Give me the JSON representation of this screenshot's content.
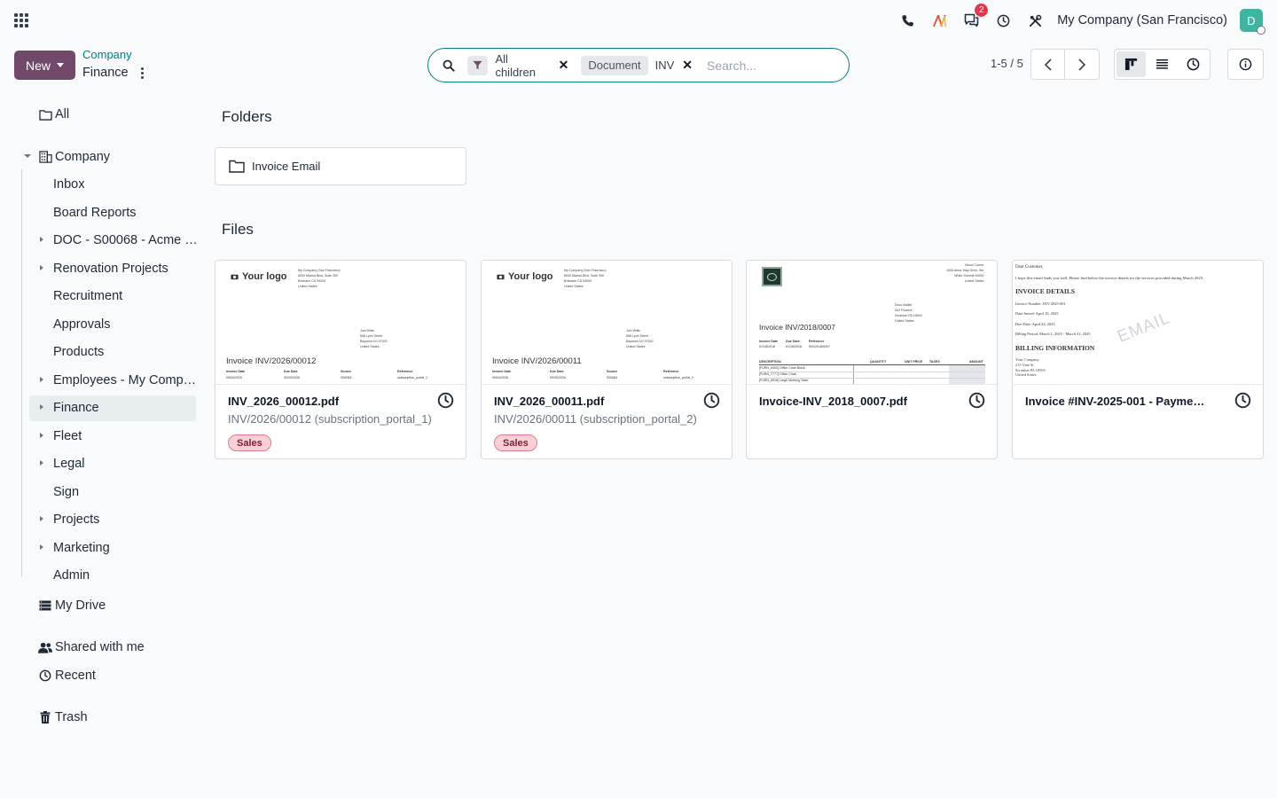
{
  "navbar": {
    "company": "My Company (San Francisco)",
    "messages_badge": "2",
    "avatar_initial": "D",
    "icons": [
      "apps-grid-icon",
      "phone-icon",
      "ai-icon",
      "messages-icon",
      "clock-icon",
      "tools-icon"
    ]
  },
  "control": {
    "new_label": "New",
    "breadcrumb_parent": "Company",
    "breadcrumb_current": "Finance"
  },
  "search": {
    "facet_filter": "All children",
    "facet_field": "Document",
    "facet_value": "INV",
    "placeholder": "Search..."
  },
  "pager": {
    "label": "1-5 / 5"
  },
  "sidebar": {
    "all": "All",
    "company": "Company",
    "children": [
      "Inbox",
      "Board Reports",
      "DOC - S00068 - Acme …",
      "Renovation Projects",
      "Recruitment",
      "Approvals",
      "Products",
      "Employees - My Comp…",
      "Finance",
      "Fleet",
      "Legal",
      "Sign",
      "Projects",
      "Marketing",
      "Admin"
    ],
    "my_drive": "My Drive",
    "shared": "Shared with me",
    "recent": "Recent",
    "trash": "Trash"
  },
  "main": {
    "folders_title": "Folders",
    "files_title": "Files",
    "folders": [
      {
        "name": "Invoice Email"
      }
    ],
    "files": [
      {
        "name": "INV_2026_00012.pdf",
        "subtitle": "INV/2026/00012 (subscription_portal_1)",
        "tag": "Sales",
        "preview": {
          "logo": "Your logo",
          "company_addr": "My Company (San Francisco)\n8000 Marina Blvd, Suite 300\nBrisbane CA 94005\nUnited States",
          "customer_addr": "Joel Willis\n858 Lynn Street\nBayonne NJ 07002\nUnited States",
          "invoice_title": "Invoice INV/2026/00012",
          "col1": "Invoice Date",
          "col2": "Due Date",
          "col3": "Source",
          "col4": "Reference",
          "val1": "09/04/2026",
          "val2": "09/30/2026",
          "val3": "S00083",
          "val4": "subscription_portal_1"
        }
      },
      {
        "name": "INV_2026_00011.pdf",
        "subtitle": "INV/2026/00011 (subscription_portal_2)",
        "tag": "Sales",
        "preview": {
          "logo": "Your logo",
          "company_addr": "My Company (San Francisco)\n8000 Marina Blvd, Suite 300\nBrisbane CA 94005\nUnited States",
          "customer_addr": "Joel Willis\n858 Lynn Street\nBayonne NJ 07002\nUnited States",
          "invoice_title": "Invoice INV/2026/00011",
          "col1": "Invoice Date",
          "col2": "Due Date",
          "col3": "Source",
          "col4": "Reference",
          "val1": "09/04/2026",
          "val2": "09/30/2026",
          "val3": "S00081",
          "val4": "subscription_portal_2"
        }
      },
      {
        "name": "Invoice-INV_2018_0007.pdf",
        "preview": {
          "company_addr": "Wood Corner\n1839 Arbor Way Drive, Ste\nWhite Summit 90000\nUnited States",
          "customer_addr": "Deco Addict\n302 Flowers\nScranton PA 18503\nUnited States",
          "invoice_title": "Invoice INV/2018/0007",
          "col1": "Invoice Date",
          "col2": "Due Date",
          "col3": "Reference",
          "val1": "01/18/2018",
          "val2": "01/18/2018",
          "val3": "INV/2018/0007",
          "th1": "DESCRIPTION",
          "th2": "QUANTITY",
          "th3": "UNIT PRICE",
          "th4": "TAXES",
          "th5": "AMOUNT",
          "line1": "[FURN_8900] Office Chair Black",
          "line2": "[FURN_7777] Office Chair",
          "line3": "[FURN_8916] Large Meeting Table"
        }
      },
      {
        "name": "Invoice #INV-2025-001 - Payme…",
        "preview": {
          "greeting": "Dear Customer,",
          "intro": "I hope this email finds you well. Please find below the invoice details for the services provided during March 2025:",
          "heading1": "INVOICE DETAILS",
          "detail1": "Invoice Number: INV-2025-001",
          "detail2": "Date Issued: April 10, 2025",
          "detail3": "Due Date: April 24, 2025",
          "detail4": "Billing Period: March 1, 2025 - March 31, 2025",
          "heading2": "BILLING INFORMATION",
          "billing": "Your Company\n215 Vine St\nScranton PA 18503\nUnited States",
          "watermark": "EMAIL"
        }
      }
    ]
  },
  "colors": {
    "primary": "#71496a",
    "link": "#017e84",
    "badge": "#e0394d",
    "tag_sales_bg": "#f9d0d8",
    "avatar": "#3fb4a0"
  }
}
